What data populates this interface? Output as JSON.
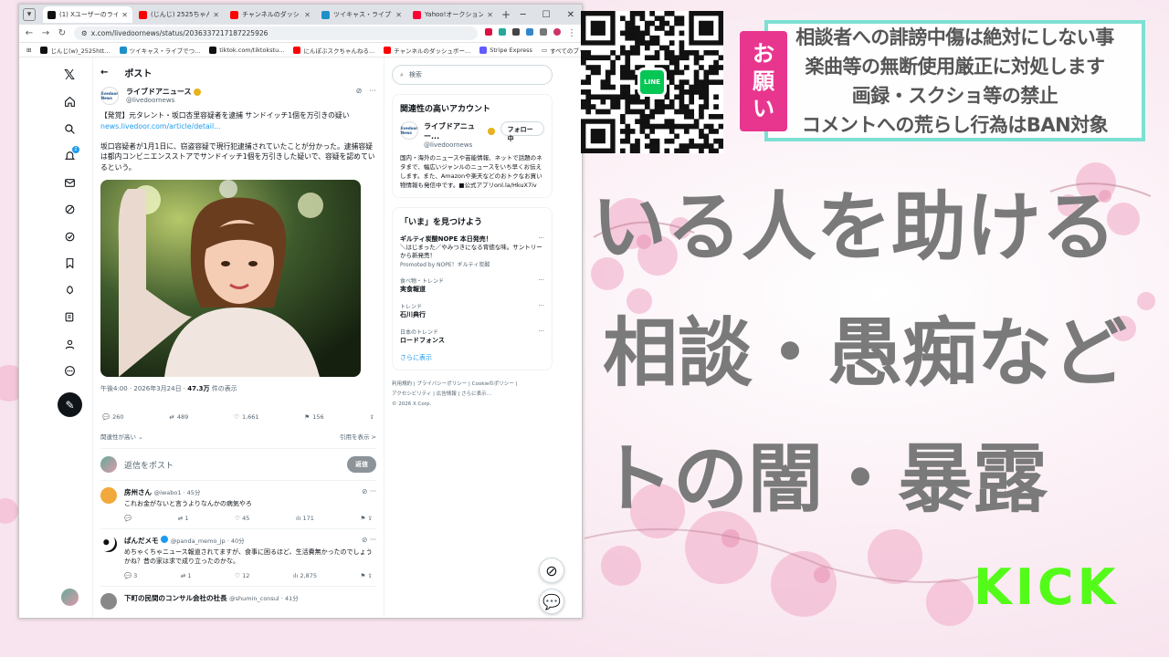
{
  "browser": {
    "tabs": [
      {
        "title": "(1) Xユーザーのライブドア",
        "color": "#111111",
        "active": true
      },
      {
        "title": "(じんじ) 2525ちゃんねるコン",
        "color": "#ff0000",
        "active": false
      },
      {
        "title": "チャンネルのダッシュボード",
        "color": "#ff0000",
        "active": false
      },
      {
        "title": "ツイキャス・ライブでつながる",
        "color": "#1e90c8",
        "active": false
      },
      {
        "title": "Yahoo!オークション - 女性",
        "color": "#ff0033",
        "active": false
      }
    ],
    "url": "x.com/livedoornews/status/2036337217187225926",
    "bookmarks": [
      {
        "label": "じんじ(w)_2525htt...",
        "color": "#111111"
      },
      {
        "label": "ツイキャス・ライブでつ...",
        "color": "#1e90c8"
      },
      {
        "label": "tiktok.com/tiktokstu...",
        "color": "#111111"
      },
      {
        "label": "にんぽぶスクちゃんねる...",
        "color": "#ff0000"
      },
      {
        "label": "チャンネルのダッシュボー...",
        "color": "#ff0000"
      },
      {
        "label": "Stripe Express",
        "color": "#635bff"
      }
    ],
    "bookmarks_right": "すべてのブックマーク"
  },
  "x": {
    "header_title": "ポスト",
    "post": {
      "name": "ライブドアニュース",
      "handle": "@livedoornews",
      "avatar_text": "livedoor News",
      "title_text": "【発覚】元タレント・坂口杏里容疑者を逮捕 サンドイッチ1個を万引きの疑い",
      "link": "news.livedoor.com/article/detail...",
      "body": "坂口容疑者が1月1日に、窃盗容疑で現行犯逮捕されていたことが分かった。逮捕容疑は都内コンビニエンスストアでサンドイッチ1個を万引きした疑いで、容疑を認めているという。",
      "meta_time": "午後4:00 · 2026年3月24日 · ",
      "meta_views": "47.3万",
      "meta_suffix": " 件の表示",
      "stats": {
        "replies": "260",
        "reposts": "489",
        "likes": "1,661",
        "bookmarks": "156"
      },
      "sort_label": "関連性が高い",
      "quote_label": "引用を表示 >"
    },
    "reply_placeholder": "返信をポスト",
    "reply_button": "返信",
    "replies": [
      {
        "name": "房州さん",
        "handle": "@iwabo1 · 45分",
        "text": "これお金がないと言うよりなんかの病気やろ",
        "stats": [
          "",
          "1",
          "45",
          "171"
        ],
        "avatar": "#f2a93b"
      },
      {
        "name": "ぱんだメモ",
        "handle": "@panda_memo_jp · 40分",
        "text": "めちゃくちゃニュース報道されてますが、食事に困るほど、生活費無かったのでしょうかね？昔の家は求で成り立ったのかな。",
        "stats": [
          "3",
          "1",
          "12",
          "2,875"
        ],
        "avatar": "#333333"
      },
      {
        "name": "下町の民間のコンサル会社の社長",
        "handle": "@shumin_consul · 41分",
        "text": "",
        "stats": [
          "",
          "",
          "",
          ""
        ],
        "avatar": "#888888"
      }
    ],
    "search_placeholder": "検索",
    "related": {
      "heading": "関連性の高いアカウント",
      "name": "ライブドアニュー...",
      "handle": "@livedoornews",
      "follow": "フォロー中",
      "bio": "国内・海外のニュースや芸能情報、ネットで話題のネタまで、幅広いジャンルのニュースをいち早くお伝えします。また、Amazonや楽天などのおトクなお買い物情報も発信中です。■公式アプリonl.la/HkuX7iv"
    },
    "trends": {
      "heading": "「いま」を見つけよう",
      "items": [
        {
          "sub": "",
          "main": "ギルティ炭酸NOPE 本日発売！",
          "desc": "＼はじまった／やみつきになる背徳な味。サントリーから新発売！",
          "promo": "Promoted by NOPE！ギルティ炭酸"
        },
        {
          "sub": "食べ物・トレンド",
          "main": "実食報道",
          "desc": "",
          "promo": ""
        },
        {
          "sub": "トレンド",
          "main": "石川典行",
          "desc": "",
          "promo": ""
        },
        {
          "sub": "日本のトレンド",
          "main": "ロードフォンス",
          "desc": "",
          "promo": ""
        }
      ],
      "more": "さらに表示"
    },
    "footer": [
      "利用規約",
      "プライバシーポリシー",
      "Cookieのポリシー",
      "アクセシビリティ",
      "広告情報",
      "さらに表示…",
      "© 2026 X Corp."
    ]
  },
  "overlay": {
    "onegai": [
      "お",
      "願",
      "い"
    ],
    "rules": [
      "相談者への誹謗中傷は絶対にしない事",
      "楽曲等の無断使用厳正に対処します",
      "画録・スクショ等の禁止",
      "コメントへの荒らし行為はBAN対象"
    ],
    "big_lines": [
      "いる人を助ける",
      "相談・愚痴など",
      "トの闇・暴露"
    ],
    "kick": "KICK",
    "line_label": "LINE"
  },
  "colors": {
    "accent_pink": "#e8368f",
    "teal_border": "#7de0d3",
    "kick_green": "#53fc18",
    "x_blue": "#1d9bf0"
  }
}
